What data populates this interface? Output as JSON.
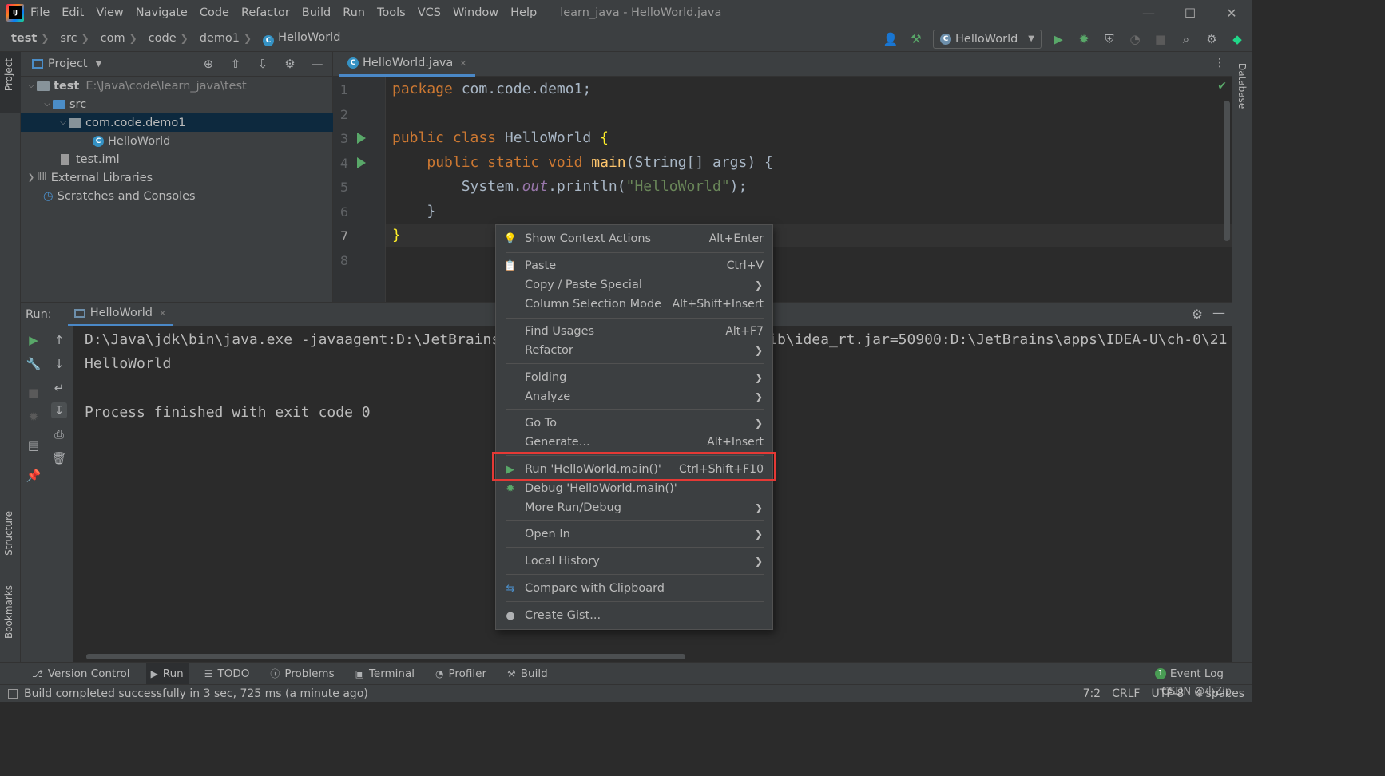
{
  "titlebar": {
    "menus": [
      "File",
      "Edit",
      "View",
      "Navigate",
      "Code",
      "Refactor",
      "Build",
      "Run",
      "Tools",
      "VCS",
      "Window",
      "Help"
    ],
    "window_title": "learn_java - HelloWorld.java"
  },
  "navbar": {
    "breadcrumbs": [
      "test",
      "src",
      "com",
      "code",
      "demo1",
      "HelloWorld"
    ],
    "run_config": "HelloWorld"
  },
  "left_strip": {
    "project": "Project",
    "structure": "Structure",
    "bookmarks": "Bookmarks"
  },
  "right_strip": {
    "database": "Database"
  },
  "project_panel": {
    "title": "Project",
    "tree": {
      "root_name": "test",
      "root_path": "E:\\Java\\code\\learn_java\\test",
      "src": "src",
      "package": "com.code.demo1",
      "class": "HelloWorld",
      "iml": "test.iml",
      "ext_libs": "External Libraries",
      "scratches": "Scratches and Consoles"
    }
  },
  "editor": {
    "tab": "HelloWorld.java",
    "line_numbers": [
      "1",
      "2",
      "3",
      "4",
      "5",
      "6",
      "7",
      "8"
    ],
    "code": {
      "l1_kw": "package",
      "l1_rest": " com.code.demo1;",
      "l3_kw": "public class",
      "l3_name": " HelloWorld ",
      "l3_brace": "{",
      "l4_kw": "public static void",
      "l4_fn": "main",
      "l4_rest": "(String[] args) {",
      "l5_a": "System.",
      "l5_fld": "out",
      "l5_b": ".println(",
      "l5_str": "\"HelloWorld\"",
      "l5_c": ");",
      "l6": "}",
      "l7": "}"
    }
  },
  "run_panel": {
    "label": "Run:",
    "tab": "HelloWorld",
    "console": [
      "D:\\Java\\jdk\\bin\\java.exe -javaagent:D:\\JetBrains\\apps\\IDEA-U\\ch-0\\213.6461.79\\lib\\idea_rt.jar=50900:D:\\JetBrains\\apps\\IDEA-U\\ch-0\\21",
      "HelloWorld",
      "",
      "Process finished with exit code 0"
    ]
  },
  "context_menu": {
    "items": [
      {
        "label": "Show Context Actions",
        "shortcut": "Alt+Enter",
        "icon": "bulb-icon"
      },
      {
        "label": "Paste",
        "shortcut": "Ctrl+V",
        "icon": "clipboard-icon"
      },
      {
        "label": "Copy / Paste Special",
        "submenu": true
      },
      {
        "label": "Column Selection Mode",
        "shortcut": "Alt+Shift+Insert"
      },
      {
        "label": "Find Usages",
        "shortcut": "Alt+F7"
      },
      {
        "label": "Refactor",
        "submenu": true
      },
      {
        "label": "Folding",
        "submenu": true
      },
      {
        "label": "Analyze",
        "submenu": true
      },
      {
        "label": "Go To",
        "submenu": true
      },
      {
        "label": "Generate...",
        "shortcut": "Alt+Insert"
      },
      {
        "label": "Run 'HelloWorld.main()'",
        "shortcut": "Ctrl+Shift+F10",
        "icon": "run-icon",
        "highlighted": true
      },
      {
        "label": "Debug 'HelloWorld.main()'",
        "icon": "debug-icon"
      },
      {
        "label": "More Run/Debug",
        "submenu": true
      },
      {
        "label": "Open In",
        "submenu": true
      },
      {
        "label": "Local History",
        "submenu": true
      },
      {
        "label": "Compare with Clipboard",
        "icon": "compare-icon"
      },
      {
        "label": "Create Gist...",
        "icon": "github-icon"
      }
    ]
  },
  "bottom_bar": {
    "items": [
      "Version Control",
      "Run",
      "TODO",
      "Problems",
      "Terminal",
      "Profiler",
      "Build"
    ],
    "event_log": "Event Log",
    "event_count": "1"
  },
  "status_bar": {
    "message": "Build completed successfully in 3 sec, 725 ms (a minute ago)",
    "position": "7:2",
    "line_sep": "CRLF",
    "encoding": "UTF-8",
    "indent": "4 spaces"
  },
  "watermark": "CSDN @小Zip",
  "colors": {
    "accent": "#4a88c7",
    "run_green": "#59a869",
    "highlight_red": "#e53935",
    "selection": "#0d293e"
  }
}
